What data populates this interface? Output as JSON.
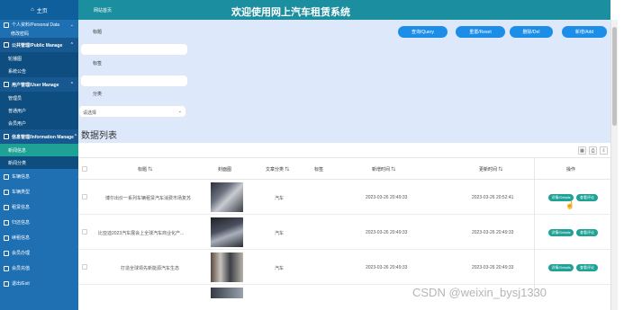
{
  "sidebar": {
    "home": "主页",
    "groups": [
      {
        "label": "个人资料/Personal Data",
        "badge": "",
        "sub": [
          "修改密码"
        ]
      },
      {
        "label": "公共管理/Public Manage",
        "sub": [
          "轮播图",
          "系统公告"
        ]
      },
      {
        "label": "用户管理/User Manage",
        "sub": [
          "管理员",
          "普通用户",
          "会员用户"
        ]
      },
      {
        "label": "信息管理/Information Manage",
        "sub": [
          "新闻信息",
          "新闻分类"
        ]
      }
    ],
    "items": [
      "车辆信息",
      "车辆类型",
      "租赁信息",
      "归还信息",
      "续租信息",
      "会员办理",
      "会员充值",
      "退出/Exit"
    ]
  },
  "header": {
    "breadcrumb": "网站首页",
    "title": "欢迎使用网上汽车租赁系统"
  },
  "filter": {
    "title_label": "标题",
    "tag_label": "标签",
    "category_label": "分类",
    "category_value": "请选择",
    "buttons": {
      "query": "查询/Query",
      "reset": "重置/Reset",
      "delete": "删除/Del",
      "add": "新增/Add"
    }
  },
  "list": {
    "section_title": "数据列表",
    "columns": [
      "标题",
      "封面图",
      "文章分类",
      "标签",
      "新增时间",
      "更新时间",
      "操作"
    ],
    "rows": [
      {
        "title": "博尔出价一系列车辆租赁汽车消费市场复苏",
        "category": "汽车",
        "tag": "",
        "created": "2023-03-26 20:49:33",
        "updated": "2023-03-26 20:52:41"
      },
      {
        "title": "比亚迪2023汽车展会上全球汽车商业化产...",
        "category": "汽车",
        "tag": "",
        "created": "2023-03-26 20:49:33",
        "updated": "2023-03-26 20:49:33"
      },
      {
        "title": "打造全球领先新能源汽车生态",
        "category": "汽车",
        "tag": "",
        "created": "2023-03-26 20:49:33",
        "updated": "2023-03-26 20:49:33"
      }
    ],
    "actions": {
      "detail": "详情/Details",
      "comments": "查看评论"
    }
  },
  "watermark": "CSDN @weixin_bysj1330"
}
